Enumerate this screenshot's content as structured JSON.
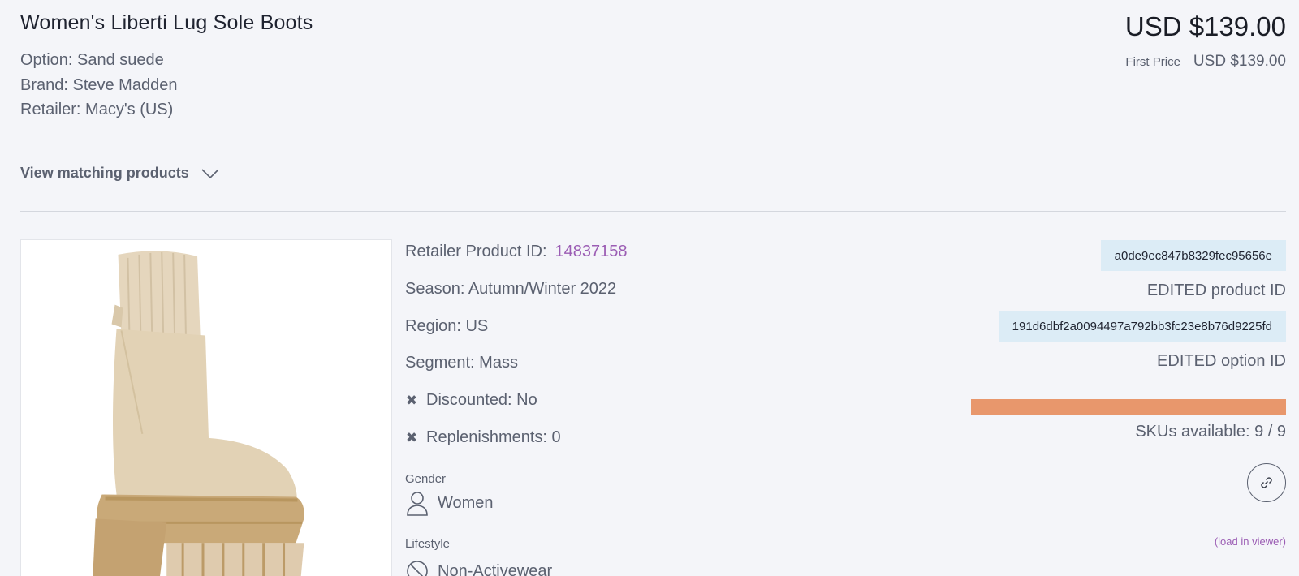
{
  "product": {
    "title": "Women's Liberti Lug Sole Boots",
    "option": "Option: Sand suede",
    "brand": "Brand: Steve Madden",
    "retailer": "Retailer: Macy's (US)"
  },
  "pricing": {
    "current": "USD $139.00",
    "first_price_label": "First Price",
    "first_price_value": "USD $139.00"
  },
  "matching": {
    "label": "View matching products",
    "icon": "chevron-down-icon"
  },
  "details": {
    "retailer_product_id_label": "Retailer Product ID:",
    "retailer_product_id": "14837158",
    "season": "Season: Autumn/Winter 2022",
    "region": "Region: US",
    "segment": "Segment: Mass",
    "discounted_mark": "✖",
    "discounted": "Discounted: No",
    "replenishments_mark": "✖",
    "replenishments": "Replenishments: 0",
    "gender_label": "Gender",
    "gender_value": "Women",
    "gender_icon": "person-icon",
    "lifestyle_label": "Lifestyle",
    "lifestyle_value": "Non-Activewear",
    "lifestyle_icon": "prohibited-icon"
  },
  "ids": {
    "product_id": "a0de9ec847b8329fec95656e",
    "product_id_caption": "EDITED product ID",
    "option_id": "191d6dbf2a0094497a792bb3fc23e8b76d9225fd",
    "option_id_caption": "EDITED option ID"
  },
  "skus": {
    "available": 9,
    "total": 9,
    "text": "SKUs available: 9 / 9",
    "bar_fraction": 1.0,
    "bar_color": "#e8976c"
  },
  "actions": {
    "link_icon": "link-icon",
    "load_viewer": "(load in viewer)"
  },
  "colors": {
    "accent_link": "#9b5db4",
    "id_pill_bg": "#dcecf6",
    "background": "#f4f5f9"
  }
}
